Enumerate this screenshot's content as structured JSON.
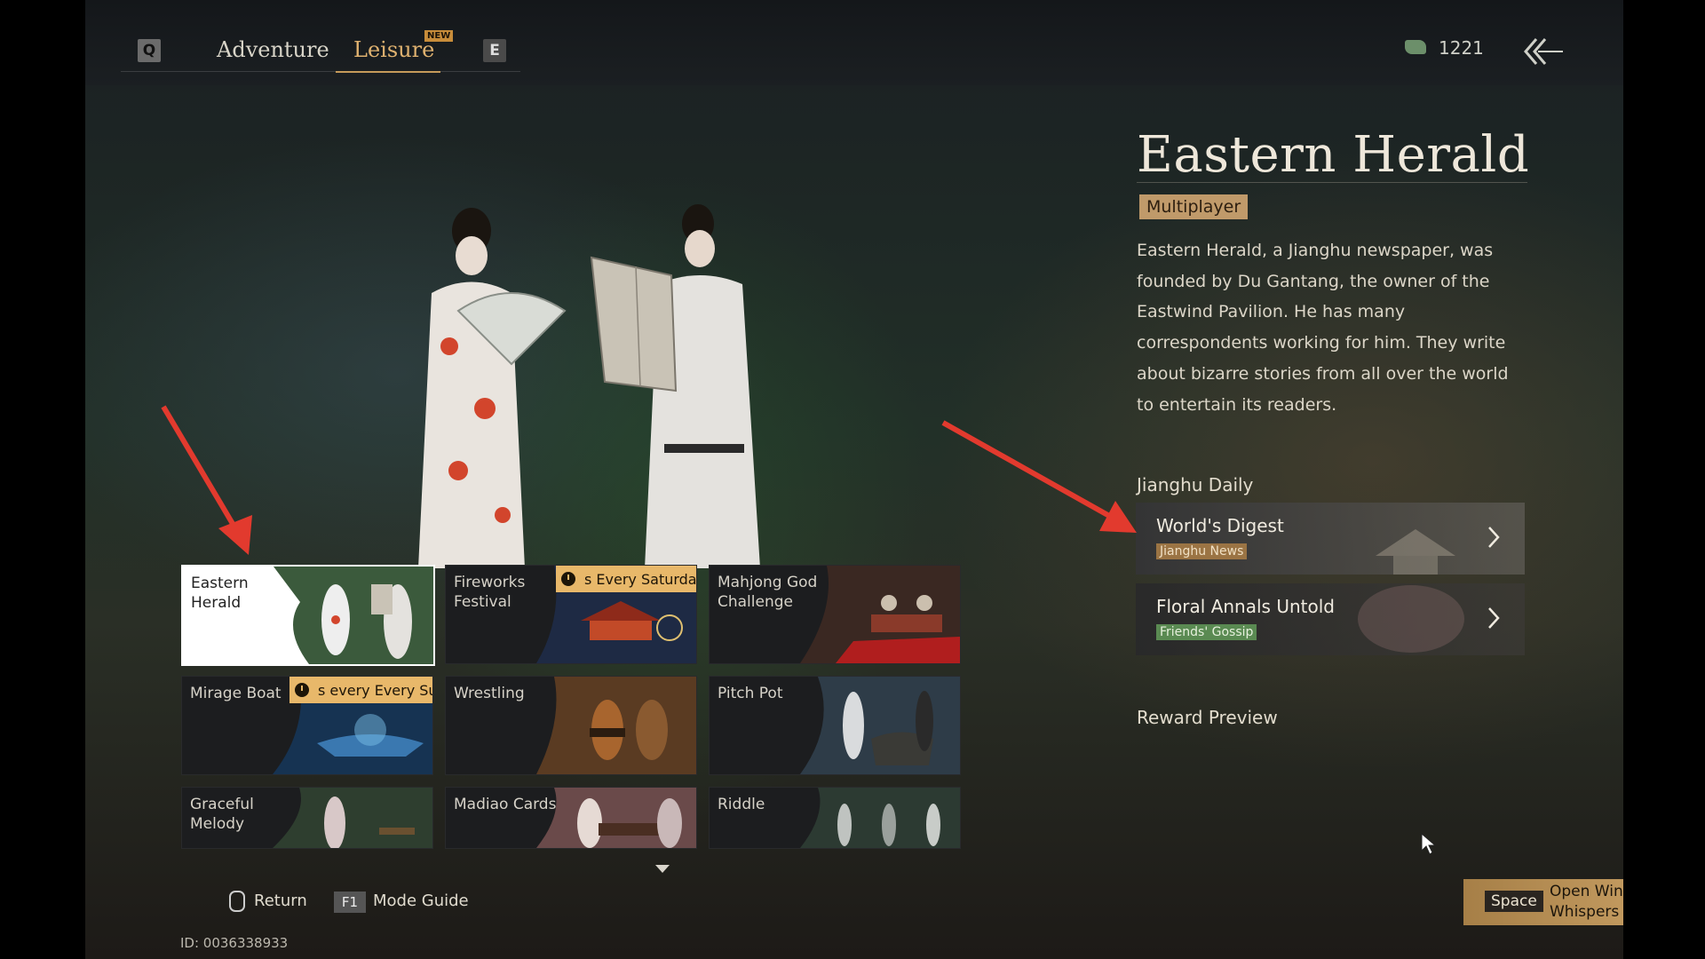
{
  "topbar": {
    "key_left": "Q",
    "key_right": "E",
    "tabs": [
      {
        "label": "Adventure",
        "active": false
      },
      {
        "label": "Leisure",
        "active": true,
        "badge": "NEW"
      }
    ],
    "currency": {
      "icon": "jade-currency-icon",
      "value": "1221"
    },
    "back_icon": "double-chevron-back-icon"
  },
  "detail": {
    "title": "Eastern Herald",
    "tag": "Multiplayer",
    "description": "Eastern Herald, a Jianghu newspaper, was founded by Du Gantang, the owner of the Eastwind Pavilion. He has many correspondents working for him. They write about bizarre stories from all over the world to entertain its readers.",
    "daily_heading": "Jianghu Daily",
    "daily_items": [
      {
        "name": "World's Digest",
        "tag": "Jianghu News"
      },
      {
        "name": "Floral Annals Untold",
        "tag": "Friends' Gossip"
      }
    ],
    "reward_heading": "Reward Preview"
  },
  "modes": [
    {
      "label": "Eastern Herald",
      "selected": true
    },
    {
      "label": "Fireworks Festival",
      "schedule": "s Every Saturday"
    },
    {
      "label": "Mahjong God Challenge"
    },
    {
      "label": "Mirage Boat",
      "schedule": "s every Every Su"
    },
    {
      "label": "Wrestling"
    },
    {
      "label": "Pitch Pot"
    },
    {
      "label": "Graceful Melody"
    },
    {
      "label": "Madiao Cards"
    },
    {
      "label": "Riddle"
    }
  ],
  "bottom": {
    "return_label": "Return",
    "f1_key": "F1",
    "mode_guide_label": "Mode Guide",
    "user_id": "ID: 0036338933",
    "space_key": "Space",
    "space_label": "Open Wind Whispers"
  },
  "colors": {
    "accent_gold": "#e0b270",
    "annotation_red": "#e23a2e",
    "tag_news": "#9b7444",
    "tag_gossip": "#5a8a52"
  }
}
